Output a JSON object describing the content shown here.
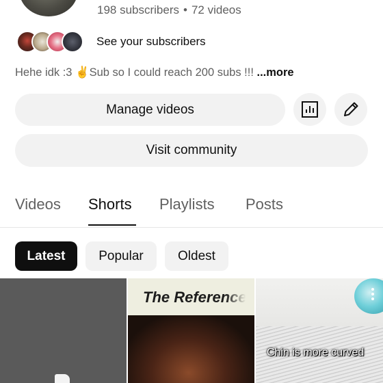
{
  "channel": {
    "subscribers": "198 subscribers",
    "separator": "•",
    "videos": "72 videos",
    "see_subscribers": "See your subscribers",
    "description": "Hehe idk :3 ✌️Sub so I could reach 200 subs !!! ",
    "more_label": "...more"
  },
  "buttons": {
    "manage_videos": "Manage videos",
    "visit_community": "Visit community",
    "analytics_icon": "analytics-icon",
    "edit_icon": "edit-icon"
  },
  "tabs": [
    {
      "label": "Videos"
    },
    {
      "label": "Shorts"
    },
    {
      "label": "Playlists"
    },
    {
      "label": "Posts"
    }
  ],
  "active_tab": "Shorts",
  "chips": [
    {
      "label": "Latest",
      "selected": true
    },
    {
      "label": "Popular",
      "selected": false
    },
    {
      "label": "Oldest",
      "selected": false
    }
  ],
  "shorts": [
    {
      "title_text": "",
      "icon": "document-icon"
    },
    {
      "title_text": "The Reference"
    },
    {
      "caption": "Chin is more curved",
      "menu_icon": "more-vertical-icon"
    }
  ]
}
